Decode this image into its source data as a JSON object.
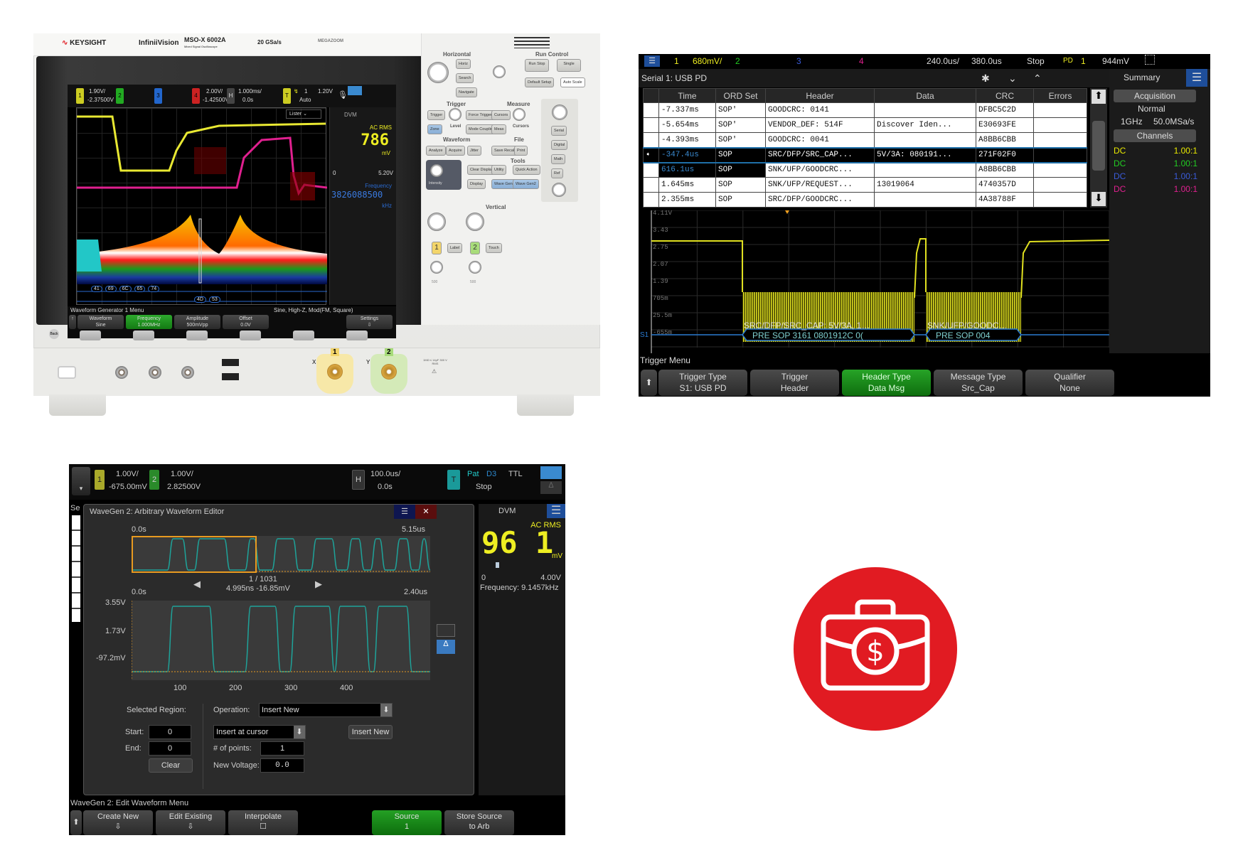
{
  "photo": {
    "brand": "KEYSIGHT",
    "series": "InfiniiVision",
    "model": "MSO-X 6002A",
    "model_sub": "Mixed Signal Oscilloscope",
    "sample_rate": "20 GSa/s",
    "megazoom": "MEGAZOOM",
    "status": {
      "ch1": "1",
      "ch1_scale": "1.90V/",
      "ch1_offset": "-2.37500V",
      "ch2": "2",
      "ch3": "3",
      "ch4": "4",
      "ch4_scale": "2.00V/",
      "ch4_offset": "-1.42500V",
      "h": "H",
      "h_scale": "1.000ms/",
      "h_delay": "0.0s",
      "t": "T",
      "trig_src": "1",
      "trig_mode": "Auto",
      "trig_level": "1.20V"
    },
    "lister": "Lister",
    "dvm": {
      "title": "DVM",
      "mode": "AC RMS",
      "value": "786",
      "unit": "mV",
      "scale_min": "0",
      "scale_max": "5.20V",
      "freq_label": "Frequency",
      "freq_value": "3826088500",
      "freq_unit": "kHz"
    },
    "decode_row1": [
      "41",
      "69",
      "6C",
      "65",
      "74"
    ],
    "decode_row2": [
      "4D",
      "53"
    ],
    "menu": {
      "title": "Waveform Generator 1 Menu",
      "info": "Sine, High-Z, Mod(FM, Square)",
      "keys": [
        {
          "top": "Waveform",
          "bottom": "Sine"
        },
        {
          "top": "Frequency",
          "bottom": "1.000MHz"
        },
        {
          "top": "Amplitude",
          "bottom": "500mVpp"
        },
        {
          "top": "Offset",
          "bottom": "0.0V"
        },
        {
          "top": "Settings",
          "bottom": "⇩"
        }
      ]
    },
    "panel": {
      "sections": {
        "horizontal": "Horizontal",
        "run": "Run Control",
        "trigger": "Trigger",
        "measure": "Measure",
        "waveform": "Waveform",
        "file": "File",
        "tools": "Tools",
        "vertical": "Vertical"
      },
      "buttons": {
        "horiz": "Horiz",
        "search": "Search",
        "navigate": "Navigate",
        "runstop": "Run Stop",
        "single": "Single",
        "default": "Default Setup",
        "autoscale": "Auto Scale",
        "trigger": "Trigger",
        "force": "Force Trigger",
        "zone": "Zone",
        "level": "Level",
        "mode": "Mode Coupling",
        "cursors": "Cursors",
        "meas": "Meas",
        "cursors_knob": "Cursors",
        "analyze": "Analyze",
        "acquire": "Acquire",
        "jitter": "Jitter",
        "save": "Save Recall",
        "print": "Print",
        "clear": "Clear Display",
        "display": "Display",
        "utility": "Utility",
        "quick": "Quick Action",
        "wg1": "Wave Gen1",
        "wg2": "Wave Gen2",
        "serial": "Serial",
        "digital": "Digital",
        "math": "Math",
        "ref": "Ref",
        "ch1": "1",
        "label": "Label",
        "ch2": "2",
        "touch": "Touch",
        "intensity": "Intensity",
        "v1": "500",
        "v2": "500"
      }
    },
    "front": {
      "back": "Back",
      "x": "X",
      "y": "Y",
      "ch1": "1",
      "ch2": "2",
      "spec": "1MΩ ≤ 14pF 300 V RMS"
    }
  },
  "serial": {
    "topbar": {
      "menu_icon": "menu-icon",
      "ch1": "1",
      "ch1_scale": "680mV/",
      "ch2": "2",
      "ch3": "3",
      "ch4": "4",
      "time_scale": "240.0us/",
      "delay": "380.0us",
      "run_state": "Stop",
      "trig_type": "PD",
      "trig_src": "1",
      "trig_level": "944mV"
    },
    "title": "Serial 1: USB PD",
    "columns": [
      "",
      "Time",
      "ORD Set",
      "Header",
      "Data",
      "CRC",
      "Errors"
    ],
    "rows": [
      [
        "",
        "-7.337ms",
        "SOP'",
        "GOODCRC: 0141",
        "",
        "DFBC5C2D",
        ""
      ],
      [
        "",
        "-5.654ms",
        "SOP'",
        "VENDOR_DEF: 514F",
        "Discover Iden...",
        "E30693FE",
        ""
      ],
      [
        "",
        "-4.393ms",
        "SOP'",
        "GOODCRC: 0041",
        "",
        "A8BB6CBB",
        ""
      ],
      [
        "➧",
        "-347.4us",
        "SOP",
        "SRC/DFP/SRC_CAP...",
        "5V/3A: 080191...",
        "271F02F0",
        ""
      ],
      [
        "",
        "616.1us",
        "SOP",
        "SNK/UFP/GOODCRC...",
        "",
        "A8BB6CBB",
        ""
      ],
      [
        "",
        "1.645ms",
        "SOP",
        "SNK/UFP/REQUEST...",
        "13019064",
        "4740357D",
        ""
      ],
      [
        "",
        "2.355ms",
        "SOP",
        "SRC/DFP/GOODCRC...",
        "",
        "4A38788F",
        ""
      ]
    ],
    "selected_row": 3,
    "y_labels": [
      "4.11V",
      "3.43",
      "2.75",
      "2.07",
      "1.39",
      "705m",
      "25.5m",
      "-655m"
    ],
    "packets": [
      {
        "label": "SRC/DFP/SRC_CAP: 5V/3A, 1…",
        "decode": "PRE SOP 3161 0801912C 0("
      },
      {
        "label": "SNK/UFP/GOODC…",
        "decode": "PRE SOP 004"
      }
    ],
    "s1": "S1",
    "trigger_menu": "Trigger Menu",
    "softkeys": [
      {
        "top": "Trigger Type",
        "bottom": "S1: USB PD"
      },
      {
        "top": "Trigger",
        "bottom": "Header"
      },
      {
        "top": "Header Type",
        "bottom": "Data Msg",
        "active": true
      },
      {
        "top": "Message Type",
        "bottom": "Src_Cap"
      },
      {
        "top": "Qualifier",
        "bottom": "None"
      }
    ],
    "sidebar": {
      "tab": "Summary",
      "acq": "Acquisition",
      "acq_mode": "Normal",
      "bw": "1GHz",
      "rate": "50.0MSa/s",
      "channels": "Channels",
      "ch_rows": [
        {
          "coupling": "DC",
          "probe": "1.00:1",
          "color": "#e8e800"
        },
        {
          "coupling": "DC",
          "probe": "1.00:1",
          "color": "#22cc22"
        },
        {
          "coupling": "DC",
          "probe": "1.00:1",
          "color": "#3a5bd9"
        },
        {
          "coupling": "DC",
          "probe": "1.00:1",
          "color": "#e0208f"
        }
      ]
    }
  },
  "wavegen": {
    "topbar": {
      "ch1": "1",
      "ch1_scale": "1.00V/",
      "ch1_offset": "-675.00mV",
      "ch2": "2",
      "ch2_scale": "1.00V/",
      "ch2_offset": "2.82500V",
      "h": "H",
      "h_scale": "100.0us/",
      "h_delay": "0.0s",
      "t": "T",
      "trig_type": "Pat",
      "trig_src": "D3",
      "trig_level": "TTL",
      "run_state": "Stop"
    },
    "hidden_tab": "Se",
    "dialog": {
      "title": "WaveGen 2: Arbitrary Waveform Editor",
      "ov_start": "0.0s",
      "ov_end": "5.15us",
      "point": "1 / 1031",
      "point_value": "4.995ns  -16.85mV",
      "main_start": "0.0s",
      "main_end": "2.40us",
      "y_labels": [
        "3.55V",
        "1.73V",
        "-97.2mV"
      ],
      "x_labels": [
        "100",
        "200",
        "300",
        "400"
      ],
      "selected_region": "Selected Region:",
      "start_label": "Start:",
      "start_value": "0",
      "end_label": "End:",
      "end_value": "0",
      "clear": "Clear",
      "operation_label": "Operation:",
      "operation_value": "Insert New",
      "insert_mode": "Insert at cursor",
      "insert_button": "Insert New",
      "points_label": "# of points:",
      "points_value": "1",
      "voltage_label": "New Voltage:",
      "voltage_value": "0.0"
    },
    "dvm": {
      "title": "DVM",
      "mode": "AC RMS",
      "value": "96 1",
      "unit": "mV",
      "scale_min": "0",
      "scale_max": "4.00V",
      "frequency": "Frequency: 9.1457kHz"
    },
    "menu_title": "WaveGen 2: Edit Waveform Menu",
    "softkeys": [
      {
        "top": "Create New",
        "bottom": "⇩"
      },
      {
        "top": "Edit Existing",
        "bottom": "⇩"
      },
      {
        "top": "Interpolate",
        "bottom": "☐"
      },
      {
        "top": "Source",
        "bottom": "1",
        "active": true
      },
      {
        "top": "Store Source",
        "bottom": "to Arb"
      }
    ]
  },
  "badge": {
    "icon": "briefcase-dollar-icon",
    "color": "#e11b22"
  }
}
